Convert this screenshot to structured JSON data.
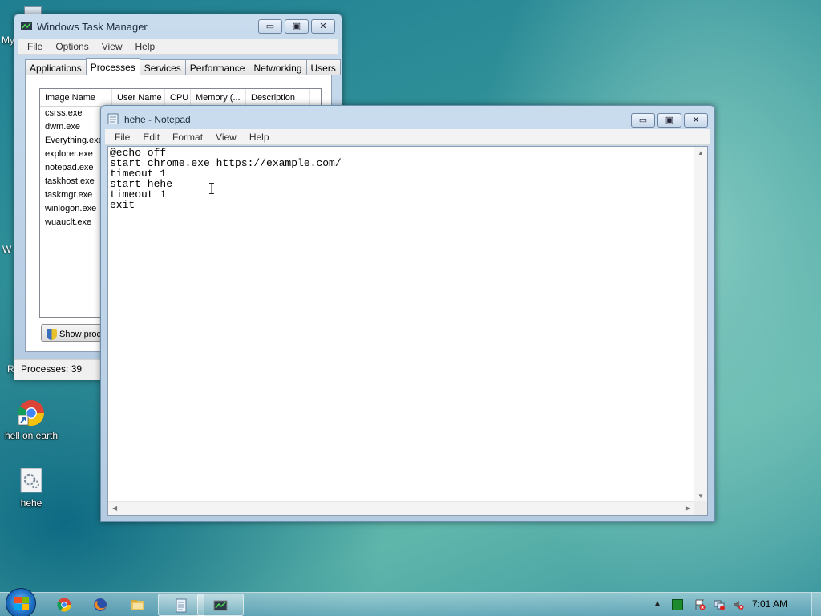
{
  "desktop": {
    "icons": [
      {
        "label": "hell on earth",
        "icon": "chrome-shortcut-icon"
      },
      {
        "label": "hehe",
        "icon": "batch-file-icon"
      }
    ],
    "edge_labels": [
      "My",
      "W",
      "R"
    ]
  },
  "task_manager": {
    "title": "Windows Task Manager",
    "menu": [
      "File",
      "Options",
      "View",
      "Help"
    ],
    "tabs": [
      "Applications",
      "Processes",
      "Services",
      "Performance",
      "Networking",
      "Users"
    ],
    "active_tab": "Processes",
    "columns": [
      "Image Name",
      "User Name",
      "CPU",
      "Memory (...",
      "Description"
    ],
    "processes": [
      "csrss.exe",
      "dwm.exe",
      "Everything.exe",
      "explorer.exe",
      "notepad.exe",
      "taskhost.exe",
      "taskmgr.exe",
      "winlogon.exe",
      "wuauclt.exe"
    ],
    "show_processes_label": "Show proce",
    "status": "Processes: 39"
  },
  "notepad": {
    "title": "hehe - Notepad",
    "menu": [
      "File",
      "Edit",
      "Format",
      "View",
      "Help"
    ],
    "content": "@echo off\nstart chrome.exe https://example.com/\ntimeout 1\nstart hehe\ntimeout 1\nexit"
  },
  "window_controls": {
    "minimize": "▭",
    "maximize": "▣",
    "close": "✕"
  },
  "taskbar": {
    "clock": "7:01 AM",
    "pinned": [
      "chrome-icon",
      "firefox-icon",
      "explorer-folder-icon",
      "notepad-icon",
      "task-manager-icon"
    ]
  },
  "colors": {
    "desktop": "#2f8f98",
    "title_bar": "#c9dcee",
    "close_hover": "#c9453a"
  }
}
